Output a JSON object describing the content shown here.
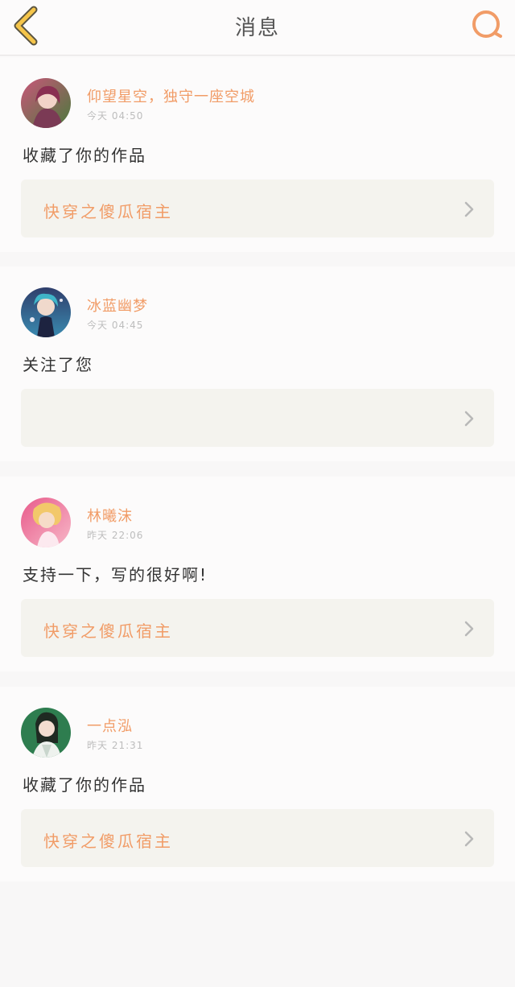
{
  "header": {
    "title": "消息",
    "back_icon": "chevron-left-icon",
    "search_icon": "search-icon",
    "accent_color": "#f19c67",
    "back_color": "#f5c54a"
  },
  "messages": [
    {
      "username": "仰望星空，独守一座空城",
      "time": "今天 04:50",
      "text": "收藏了你的作品",
      "work_title": "快穿之傻瓜宿主",
      "avatar_colors": [
        "#c9567a",
        "#4a7a3c"
      ]
    },
    {
      "username": "冰蓝幽梦",
      "time": "今天 04:45",
      "text": "关注了您",
      "work_title": "",
      "avatar_colors": [
        "#2f3e6b",
        "#3a8ab0"
      ]
    },
    {
      "username": "林曦沫",
      "time": "昨天 22:06",
      "text": "支持一下，写的很好啊!",
      "work_title": "快穿之傻瓜宿主",
      "avatar_colors": [
        "#e85a8a",
        "#f2c86a"
      ]
    },
    {
      "username": "一点泓",
      "time": "昨天 21:31",
      "text": "收藏了你的作品",
      "work_title": "快穿之傻瓜宿主",
      "avatar_colors": [
        "#2e7d4f",
        "#1f2a22"
      ]
    }
  ]
}
